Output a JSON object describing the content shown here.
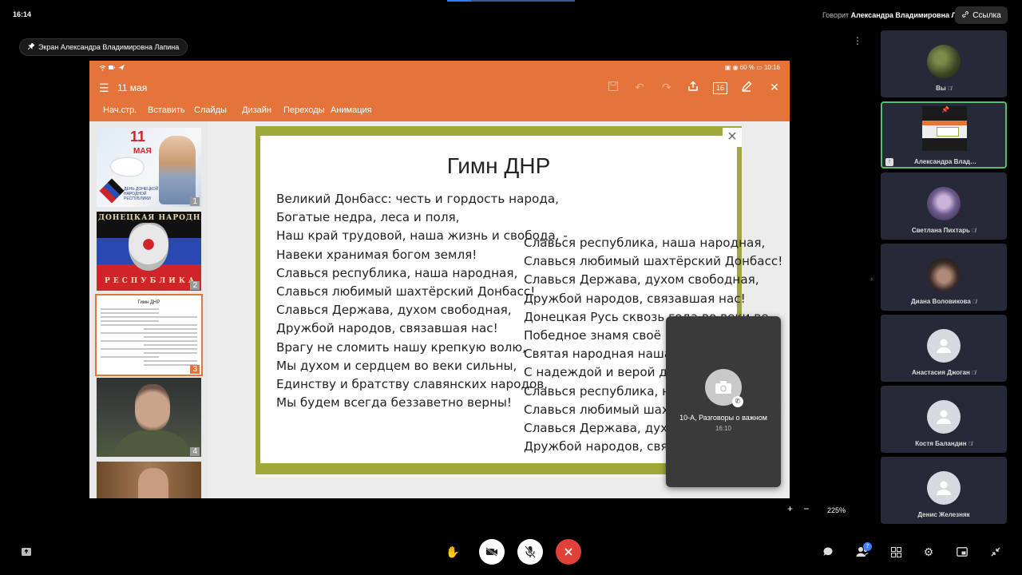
{
  "topbar": {
    "clock": "16:14",
    "speaker_prefix": "Говорит",
    "speaker_name": "Александра Владимировна Л.",
    "link_label": "Ссылка"
  },
  "share": {
    "screen_label": "Экран Александра Владимировна Лапина"
  },
  "tablet": {
    "status_right": "60 %",
    "status_time": "10:16",
    "doc_title": "11 мая",
    "page_badge": "16",
    "ribbon": [
      "Нач.стр.",
      "Вставить",
      "Слайды",
      "Дизайн",
      "Переходы",
      "Анимация"
    ]
  },
  "thumbs": {
    "t1_day": "11",
    "t1_month": "МАЯ",
    "t1_caption": "ДЕНЬ ДОНЕЦКОЙ НАРОДНОЙ РЕСПУБЛИКИ",
    "t2_top": "ДОНЕЦКАЯ НАРОДНАЯ",
    "t2_bottom": "РЕСПУБЛИКА",
    "t3_title": "Гимн ДНР",
    "numbers": [
      "1",
      "2",
      "3",
      "4"
    ]
  },
  "slide": {
    "title": "Гимн ДНР",
    "col1": [
      "Великий Донбасс: честь и гордость народа,",
      "Богатые недра, леса и поля,",
      "Наш край трудовой, наша жизнь и свобода, -",
      "Навеки хранимая богом земля!",
      "Славься республика, наша народная,",
      "Славься любимый шахтёрский Донбасс!",
      "Славься Держава, духом свободная,",
      "Дружбой народов, связавшая нас!",
      "Врагу не сломить нашу крепкую волю,",
      "Мы духом и сердцем во веки сильны,",
      "Единству и братству славянских народов,",
      "Мы будем всегда беззаветно верны!"
    ],
    "col2": [
      "Славься республика, наша народная,",
      "Славься любимый шахтёрский Донбасс!",
      "Славься Держава, духом свободная,",
      "Дружбой народов, связавшая нас!",
      "Донецкая Русь сквозь года во веки ве",
      "Победное знамя своё пронесёт,",
      "Святая народная наша Держава,",
      "С надеждой и верой для мира живёт.",
      "Славься республика, наша народная,",
      "Славься любимый шахтёрский Донбасс!",
      "Славься Держава, духом свободная,",
      "Дружбой народов, связавшая нас!"
    ]
  },
  "notification": {
    "title": "10-А, Разговоры о важном",
    "time": "16:10"
  },
  "zoom": {
    "plus": "+",
    "minus": "−",
    "value": "225%"
  },
  "participants": [
    {
      "name": "Вы"
    },
    {
      "name": "Александра Влад…"
    },
    {
      "name": "Светлана Пихтарь"
    },
    {
      "name": "Диана Воловикова"
    },
    {
      "name": "Анастасия Джоган"
    },
    {
      "name": "Костя Баландин"
    },
    {
      "name": "Денис Железняк"
    }
  ],
  "bottom": {
    "people_count": "7"
  },
  "colors": {
    "accent_orange": "#e4743a",
    "pinned_green": "#51c26b",
    "end_call_red": "#e0423a"
  }
}
